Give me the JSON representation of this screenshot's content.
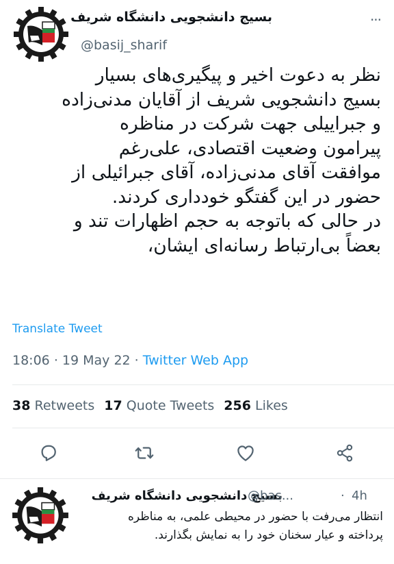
{
  "tweet": {
    "author_name": "بسیج دانشجویی دانشگاه شریف",
    "handle": "@basij_sharif",
    "more_icon": "more-icon",
    "lines": [
      "نظر به دعوت اخیر و پیگیری‌های بسیار",
      "بسیج دانشجویی شریف از آقایان مدنی‌زاده",
      "و جبراییلی جهت شرکت در مناظره",
      "پیرامون وضعیت اقتصادی، علی‌رغم",
      "موافقت آقای مدنی‌زاده، آقای جبرائیلی از",
      "حضور در این گفتگو خودداری کردند.",
      "در حالی که باتوجه به حجم اظهارات تند و",
      "بعضاً بی‌ارتباط رسانه‌ای ایشان،"
    ],
    "translate_label": "Translate Tweet",
    "time": "18:06",
    "date": "19 May 22",
    "separator": "·",
    "app": "Twitter Web App"
  },
  "stats": {
    "retweets_count": "38",
    "retweets_label": "Retweets",
    "quotes_count": "17",
    "quotes_label": "Quote Tweets",
    "likes_count": "256",
    "likes_label": "Likes"
  },
  "actions": [
    "reply-icon",
    "retweet-icon",
    "like-icon",
    "share-icon"
  ],
  "reply": {
    "author_name": "بسیج دانشجویی دانشگاه شریف",
    "handle": "@bas...",
    "separator": "·",
    "time": "4h",
    "lines": [
      "انتظار می‌رفت با حضور در محیطی علمی، به مناظره",
      "پرداخته و عیار سخنان خود را به نمایش بگذارند."
    ]
  },
  "colors": {
    "accent": "#1d9bf0",
    "secondary_text": "#536471",
    "logo_red": "#d42127",
    "logo_green": "#2a8f43"
  }
}
